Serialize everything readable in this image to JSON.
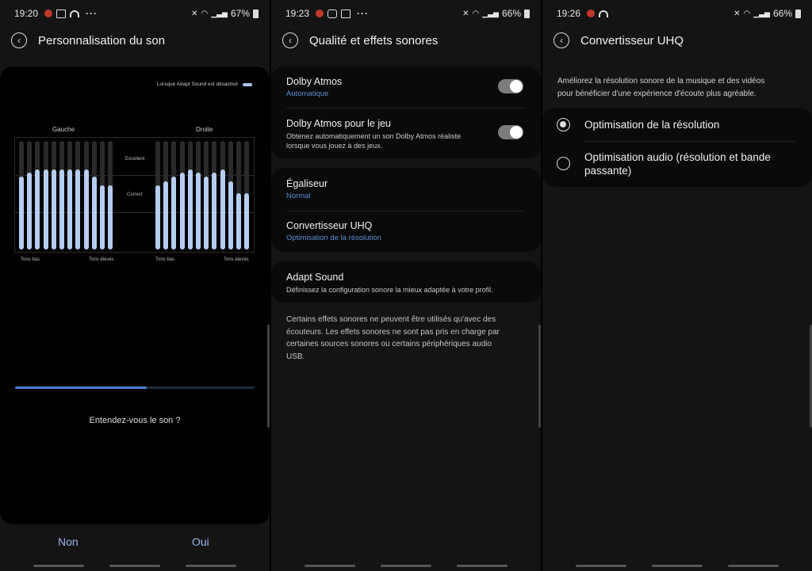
{
  "screens": [
    {
      "status": {
        "time": "19:20",
        "battery": "67%"
      },
      "title": "Personnalisation du son",
      "legend": "Lorsque Adapt Sound est désactivé",
      "left_label": "Gauche",
      "right_label": "Droite",
      "grade_excellent": "Excellent",
      "grade_correct": "Correct",
      "low_label": "Tons bas",
      "high_label": "Tons élevés",
      "left_levels": [
        0.67,
        0.71,
        0.74,
        0.74,
        0.74,
        0.74,
        0.74,
        0.74,
        0.74,
        0.67,
        0.59,
        0.59
      ],
      "right_levels": [
        0.59,
        0.63,
        0.67,
        0.71,
        0.74,
        0.71,
        0.67,
        0.71,
        0.74,
        0.63,
        0.52,
        0.52
      ],
      "progress": 0.55,
      "question": "Entendez-vous le son ?",
      "no_label": "Non",
      "yes_label": "Oui"
    },
    {
      "status": {
        "time": "19:23",
        "battery": "66%"
      },
      "title": "Qualité et effets sonores",
      "dolby": {
        "title": "Dolby Atmos",
        "sub": "Automatique",
        "on": true
      },
      "dolby_game": {
        "title": "Dolby Atmos pour le jeu",
        "desc_1": "Obtenez automatiquement un son Dolby Atmos réaliste",
        "desc_2": "lorsque vous jouez à des jeux.",
        "on": true
      },
      "eq": {
        "title": "Égaliseur",
        "sub": "Normal"
      },
      "uhq": {
        "title": "Convertisseur UHQ",
        "sub": "Optimisation de la résolution"
      },
      "adapt": {
        "title": "Adapt Sound",
        "desc": "Définissez la configuration sonore la mieux adaptée à votre profil."
      },
      "note": [
        "Certains effets sonores ne peuvent être utilisés qu'avec des",
        "écouteurs. Les effets sonores ne sont pas pris en charge par",
        "certaines sources sonores ou certains périphériques audio",
        "USB."
      ]
    },
    {
      "status": {
        "time": "19:26",
        "battery": "66%"
      },
      "title": "Convertisseur UHQ",
      "intro": [
        "Améliorez la résolution sonore de la musique et des vidéos",
        "pour bénéficier d'une expérience d'écoute plus agréable."
      ],
      "option1": "Optimisation de la résolution",
      "option2_line1": "Optimisation audio (résolution et bande",
      "option2_line2": "passante)",
      "selected": 1
    }
  ],
  "colors": {
    "accent": "#5b8dd6",
    "bar": "#b6cdef",
    "answer": "#9ab4ee",
    "progress": "#4a7fd4"
  }
}
